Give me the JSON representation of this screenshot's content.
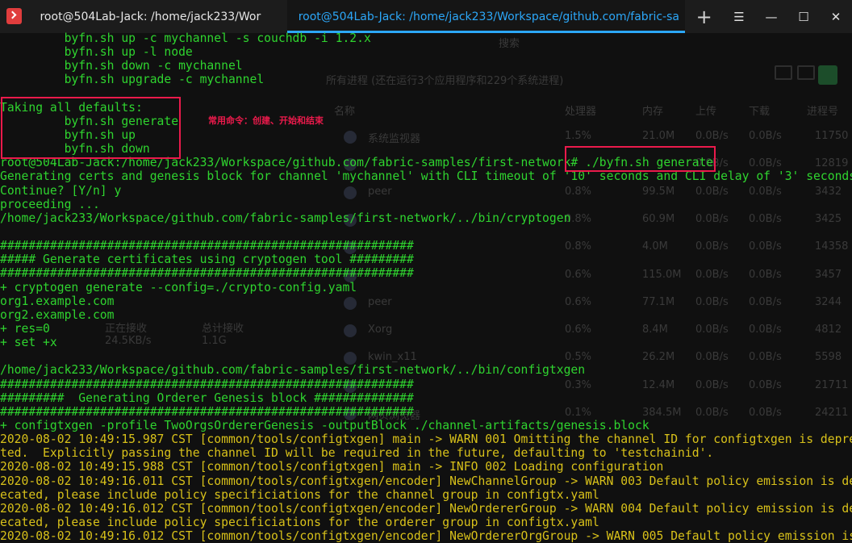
{
  "titlebar": {
    "tabs": [
      {
        "label": "root@504Lab-Jack: /home/jack233/Wor",
        "active": false
      },
      {
        "label": "root@504Lab-Jack: /home/jack233/Workspace/github.com/fabric-sa",
        "active": true
      }
    ],
    "add_tab": "+",
    "menu_icon": "☰",
    "minimize": "—",
    "maximize": "☐",
    "close": "✕"
  },
  "ghost": {
    "search": "搜索",
    "header": "所有进程  (还在运行3个应用程序和229个系统进程)",
    "columns": [
      "名称",
      "处理器",
      "内存",
      "上传",
      "下载",
      "进程号"
    ],
    "rows": [
      {
        "name": "系统监视器",
        "cpu": "1.5%",
        "mem": "21.0M",
        "up": "0.0B/s",
        "down": "0.0B/s",
        "pid": "11750"
      },
      {
        "name": "",
        "cpu": "",
        "mem": "",
        "up": "0.0B/s",
        "down": "0.0B/s",
        "pid": "12819"
      },
      {
        "name": "peer",
        "cpu": "0.8%",
        "mem": "99.5M",
        "up": "0.0B/s",
        "down": "0.0B/s",
        "pid": "3432"
      },
      {
        "name": "",
        "cpu": "0.8%",
        "mem": "60.9M",
        "up": "0.0B/s",
        "down": "0.0B/s",
        "pid": "3425"
      },
      {
        "name": "",
        "cpu": "0.8%",
        "mem": "4.0M",
        "up": "0.0B/s",
        "down": "0.0B/s",
        "pid": "14358"
      },
      {
        "name": "",
        "cpu": "0.6%",
        "mem": "115.0M",
        "up": "0.0B/s",
        "down": "0.0B/s",
        "pid": "3457"
      },
      {
        "name": "peer",
        "cpu": "0.6%",
        "mem": "77.1M",
        "up": "0.0B/s",
        "down": "0.0B/s",
        "pid": "3244"
      },
      {
        "name": "Xorg",
        "cpu": "0.6%",
        "mem": "8.4M",
        "up": "0.0B/s",
        "down": "0.0B/s",
        "pid": "4812"
      },
      {
        "name": "kwin_x11",
        "cpu": "0.5%",
        "mem": "26.2M",
        "up": "0.0B/s",
        "down": "0.0B/s",
        "pid": "5598"
      },
      {
        "name": "",
        "cpu": "0.3%",
        "mem": "12.4M",
        "up": "0.0B/s",
        "down": "0.0B/s",
        "pid": "21711"
      },
      {
        "name": "网页浏览器",
        "cpu": "0.1%",
        "mem": "384.5M",
        "up": "0.0B/s",
        "down": "0.0B/s",
        "pid": "24211"
      }
    ],
    "side_a_label": "正在接收",
    "side_a_value": "24.5KB/s",
    "side_b_label": "总计接收",
    "side_b_value": "1.1G"
  },
  "annotation": {
    "label": "常用命令：创建、开始和结束",
    "color": "#ea1a4b"
  },
  "terminal": {
    "lines": [
      {
        "text": "         byfn.sh up -c mychannel -s couchdb -i 1.2.x",
        "kind": "normal"
      },
      {
        "text": "         byfn.sh up -l node",
        "kind": "normal"
      },
      {
        "text": "         byfn.sh down -c mychannel",
        "kind": "normal"
      },
      {
        "text": "         byfn.sh upgrade -c mychannel",
        "kind": "normal"
      },
      {
        "text": "",
        "kind": "normal"
      },
      {
        "text": "Taking all defaults:",
        "kind": "normal"
      },
      {
        "text": "         byfn.sh generate",
        "kind": "normal"
      },
      {
        "text": "         byfn.sh up",
        "kind": "normal"
      },
      {
        "text": "         byfn.sh down",
        "kind": "normal"
      },
      {
        "text": "root@504Lab-Jack:/home/jack233/Workspace/github.com/fabric-samples/first-network# ./byfn.sh generate",
        "kind": "normal"
      },
      {
        "text": "Generating certs and genesis block for channel 'mychannel' with CLI timeout of '10' seconds and CLI delay of '3' seconds",
        "kind": "normal"
      },
      {
        "text": "Continue? [Y/n] y",
        "kind": "normal"
      },
      {
        "text": "proceeding ...",
        "kind": "normal"
      },
      {
        "text": "/home/jack233/Workspace/github.com/fabric-samples/first-network/../bin/cryptogen",
        "kind": "normal"
      },
      {
        "text": "",
        "kind": "normal"
      },
      {
        "text": "##########################################################",
        "kind": "normal"
      },
      {
        "text": "##### Generate certificates using cryptogen tool #########",
        "kind": "normal"
      },
      {
        "text": "##########################################################",
        "kind": "normal"
      },
      {
        "text": "+ cryptogen generate --config=./crypto-config.yaml",
        "kind": "normal"
      },
      {
        "text": "org1.example.com",
        "kind": "normal"
      },
      {
        "text": "org2.example.com",
        "kind": "normal"
      },
      {
        "text": "+ res=0",
        "kind": "normal"
      },
      {
        "text": "+ set +x",
        "kind": "normal"
      },
      {
        "text": "",
        "kind": "normal"
      },
      {
        "text": "/home/jack233/Workspace/github.com/fabric-samples/first-network/../bin/configtxgen",
        "kind": "normal"
      },
      {
        "text": "##########################################################",
        "kind": "normal"
      },
      {
        "text": "#########  Generating Orderer Genesis block ##############",
        "kind": "normal"
      },
      {
        "text": "##########################################################",
        "kind": "normal"
      },
      {
        "text": "+ configtxgen -profile TwoOrgsOrdererGenesis -outputBlock ./channel-artifacts/genesis.block",
        "kind": "normal"
      },
      {
        "text": "2020-08-02 10:49:15.987 CST [common/tools/configtxgen] main -> WARN 001 Omitting the channel ID for configtxgen is depreca",
        "kind": "warn"
      },
      {
        "text": "ted.  Explicitly passing the channel ID will be required in the future, defaulting to 'testchainid'.",
        "kind": "warn"
      },
      {
        "text": "2020-08-02 10:49:15.988 CST [common/tools/configtxgen] main -> INFO 002 Loading configuration",
        "kind": "warn"
      },
      {
        "text": "2020-08-02 10:49:16.011 CST [common/tools/configtxgen/encoder] NewChannelGroup -> WARN 003 Default policy emission is depr",
        "kind": "warn"
      },
      {
        "text": "ecated, please include policy specificiations for the channel group in configtx.yaml",
        "kind": "warn"
      },
      {
        "text": "2020-08-02 10:49:16.012 CST [common/tools/configtxgen/encoder] NewOrdererGroup -> WARN 004 Default policy emission is depr",
        "kind": "warn"
      },
      {
        "text": "ecated, please include policy specificiations for the orderer group in configtx.yaml",
        "kind": "warn"
      },
      {
        "text": "2020-08-02 10:49:16.012 CST [common/tools/configtxgen/encoder] NewOrdererOrgGroup -> WARN 005 Default policy emission is d",
        "kind": "warn"
      }
    ]
  }
}
